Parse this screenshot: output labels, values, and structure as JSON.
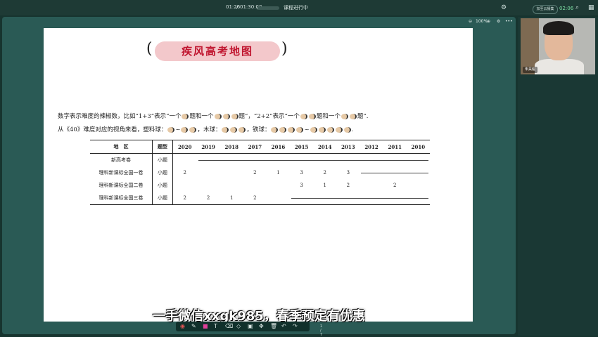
{
  "player": {
    "current_time": "01:26",
    "separator": "/",
    "total_time": "01:30:00",
    "progress": 0.016,
    "status": "课程进行中",
    "favorite_label": "加至云播集",
    "clock": "02:06"
  },
  "doc_toolbar": {
    "zoom": "100%"
  },
  "document": {
    "title": "疾风高考地图",
    "bracket_left": "(",
    "bracket_right": ")",
    "desc_line1_a": "数字表示难度的辣椒数，比如“1+3”表示“一个",
    "desc_line1_b": "题和一个",
    "desc_line1_c": "题”，“2+2”表示“一个",
    "desc_line1_d": "题和一个",
    "desc_line1_e": "题”.",
    "desc_line2_a": "从《40》难度对应的视角来看，塑料球：",
    "desc_line2_b": "~",
    "desc_line2_c": "，木球：",
    "desc_line2_d": "，铁球：",
    "desc_line2_e": "~",
    "desc_line2_f": ".",
    "table": {
      "header_region": "地　区",
      "header_type": "题型",
      "years": [
        "2020",
        "2019",
        "2018",
        "2017",
        "2016",
        "2015",
        "2014",
        "2013",
        "2012",
        "2011",
        "2010"
      ],
      "rows": [
        {
          "region": "新高考卷",
          "type": "小题",
          "cells": [
            "",
            "",
            "",
            "",
            "",
            "",
            "",
            "",
            "",
            "",
            ""
          ]
        },
        {
          "region": "理科新课标全国一卷",
          "type": "小题",
          "cells": [
            "2",
            "",
            "",
            "2",
            "1",
            "3",
            "2",
            "3",
            "",
            "",
            ""
          ]
        },
        {
          "region": "理科新课标全国二卷",
          "type": "小题",
          "cells": [
            "",
            "",
            "",
            "",
            "",
            "3",
            "1",
            "2",
            "",
            "2",
            ""
          ]
        },
        {
          "region": "理科新课标全国三卷",
          "type": "小题",
          "cells": [
            "2",
            "2",
            "1",
            "2",
            "",
            "",
            "",
            "",
            "",
            "",
            ""
          ]
        }
      ]
    }
  },
  "camera": {
    "name_tag": "朱昊鲲"
  },
  "subtitle": "一手微信xxgk985，春季预定有优惠",
  "bottom_toolbar": {
    "page_indicator": "1 / 7"
  },
  "colors": {
    "accent_green": "#7fe3a6",
    "title_red": "#c0152f",
    "title_pill": "#f3c8cb"
  }
}
